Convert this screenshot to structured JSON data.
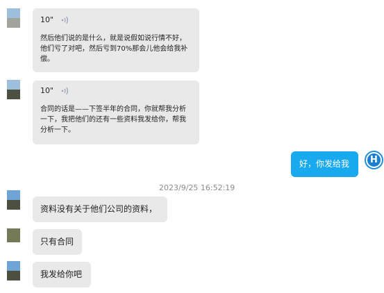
{
  "messages": [
    {
      "sender": "other",
      "type": "voice",
      "duration": "10\"",
      "transcript": "然后他们说的是什么，就是说假如说行情不好，他们亏了对吧，然后亏到70%那会儿他会给我补偿。"
    },
    {
      "sender": "other",
      "type": "voice",
      "duration": "10\"",
      "transcript": "合同的话是——下签半年的合同，你就帮我分析一下，我把他们的还有一些资料我发给你，帮我分析一下。"
    },
    {
      "sender": "self",
      "type": "text",
      "text": "好，你发给我"
    },
    {
      "type": "timestamp",
      "text": "2023/9/25 16:52:19"
    },
    {
      "sender": "other",
      "type": "text",
      "text": "资料没有关于他们公司的资料，"
    },
    {
      "sender": "other",
      "type": "text",
      "text": "只有合同"
    },
    {
      "sender": "other",
      "type": "text",
      "text": "我发给你吧"
    }
  ],
  "self_avatar": {
    "letter": "H"
  },
  "colors": {
    "incoming_bubble": "#e9e9e9",
    "outgoing_bubble": "#18a9ee",
    "timestamp": "#8a8a8a",
    "voice_icon": "#9aa5b8"
  },
  "icons": {
    "voice": "sound-wave-icon"
  }
}
